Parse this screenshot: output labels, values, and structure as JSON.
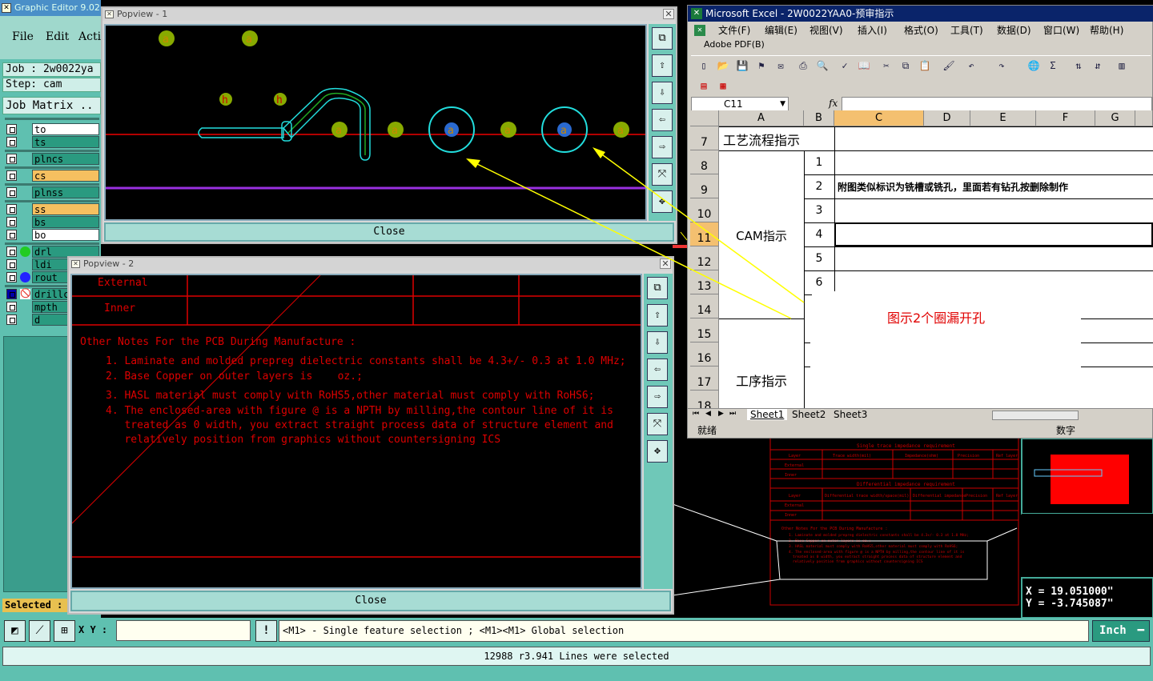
{
  "graphic_editor": {
    "title": "Graphic Editor 9.02",
    "menu": [
      "File",
      "Edit",
      "Acti"
    ],
    "job": "Job : 2w0022ya",
    "step": "Step: cam",
    "job_matrix": "Job Matrix ..",
    "layers": [
      {
        "name": "to",
        "color": "#ffffff"
      },
      {
        "name": "ts",
        "color": "#2a9a80"
      },
      {
        "name": "plncs",
        "color": "#2a9a80"
      },
      {
        "name": "cs",
        "color": "#f6c060"
      },
      {
        "name": "plnss",
        "color": "#2a9a80"
      },
      {
        "name": "ss",
        "color": "#f6c060"
      },
      {
        "name": "bs",
        "color": "#2a9a80"
      },
      {
        "name": "bo",
        "color": "#ffffff"
      },
      {
        "name": "drl",
        "color": "#2a9a80"
      },
      {
        "name": "ldi",
        "color": "#2a9a80"
      },
      {
        "name": "rout",
        "color": "#2a9a80"
      },
      {
        "name": "drillc",
        "color": "#2a9a80"
      },
      {
        "name": "mpth",
        "color": "#2a9a80"
      },
      {
        "name": "d",
        "color": "#2a9a80"
      }
    ],
    "selected_label": "Selected :"
  },
  "popview1": {
    "title": "Popview - 1",
    "close_label": "Close",
    "pad_label": "a",
    "hole_label": "h"
  },
  "popview2": {
    "title": "Popview - 2",
    "close_label": "Close",
    "table_rows": [
      "External",
      "Inner"
    ],
    "notes_title": "Other Notes For the PCB During Manufacture :",
    "notes": [
      "1. Laminate and molded prepreg dielectric constants shall be 4.3+/- 0.3 at 1.0 MHz;",
      "2. Base Copper on outer layers is    oz.;",
      "3. HASL material must comply with RoHS5,other material must comply with RoHS6;",
      "4. The enclosed-area with figure @ is a NPTH by milling,the contour line of it is",
      "   treated as 0 width, you extract straight process data of structure element and",
      "   relatively position from graphics without countersigning ICS"
    ]
  },
  "excel": {
    "title": "Microsoft Excel - 2W0022YAA0-预审指示",
    "menu": [
      "文件(F)",
      "编辑(E)",
      "视图(V)",
      "插入(I)",
      "格式(O)",
      "工具(T)",
      "数据(D)",
      "窗口(W)",
      "帮助(H)"
    ],
    "adobe_menu": "Adobe PDF(B)",
    "name_box": "C11",
    "fx": "fx",
    "columns": [
      "A",
      "B",
      "C",
      "D",
      "E",
      "F",
      "G"
    ],
    "rows": [
      "7",
      "8",
      "9",
      "10",
      "11",
      "12",
      "13",
      "14",
      "15",
      "16",
      "17",
      "18"
    ],
    "cells": {
      "process_title": "工艺流程指示",
      "cam_title": "CAM指示",
      "op_title": "工序指示",
      "nums": [
        "1",
        "2",
        "3",
        "4",
        "5",
        "6"
      ],
      "note_2": "附图类似标识为铣槽或铣孔，里面若有钻孔按删除制作"
    },
    "sheets": [
      "Sheet1",
      "Sheet2",
      "Sheet3"
    ],
    "status_left": "就绪",
    "status_right": "数字"
  },
  "annotation": {
    "text": "图示2个圈漏开孔",
    "color": "#e00000",
    "arrow_color": "#ffff00"
  },
  "coords": {
    "x": "X  =  19.051000\"",
    "y": "Y  =  -3.745087\""
  },
  "bottom": {
    "xy_label": "X Y :",
    "hint": "<M1> - Single feature selection ; <M1><M1> Global selection",
    "units": "Inch",
    "status": "12988 r3.941 Lines were selected"
  },
  "background_table": {
    "title": "Single trace impedance requirement",
    "headers": [
      "Layer",
      "Trace width(mil)",
      "Impedance(ohm)",
      "Precision",
      "Ref layer"
    ],
    "rows": [
      "External",
      "Inner"
    ],
    "diff_title": "Differential impedance requirement",
    "diff_headers": [
      "Layer",
      "Differential trace width/space(mil)",
      "Differential impedance",
      "Precision",
      "Ref layer"
    ],
    "notes_title": "Other Notes For the PCB During Manufacture :",
    "notes": [
      "1. Laminate and molded prepreg dielectric constants shall be 4.3+/- 0.3 at 1.0 MHz;",
      "2. Base Copper on outer layers is   oz.;",
      "3. HASL material must comply with RoHS5,other material must comply with RoHS6;",
      "4. The enclosed-area with figure @ is a NPTH by milling,the contour line of it is",
      "   treated as 0 width, you extract straight process data of structure element and",
      "   relatively position from graphics without countersigning ICS"
    ]
  }
}
